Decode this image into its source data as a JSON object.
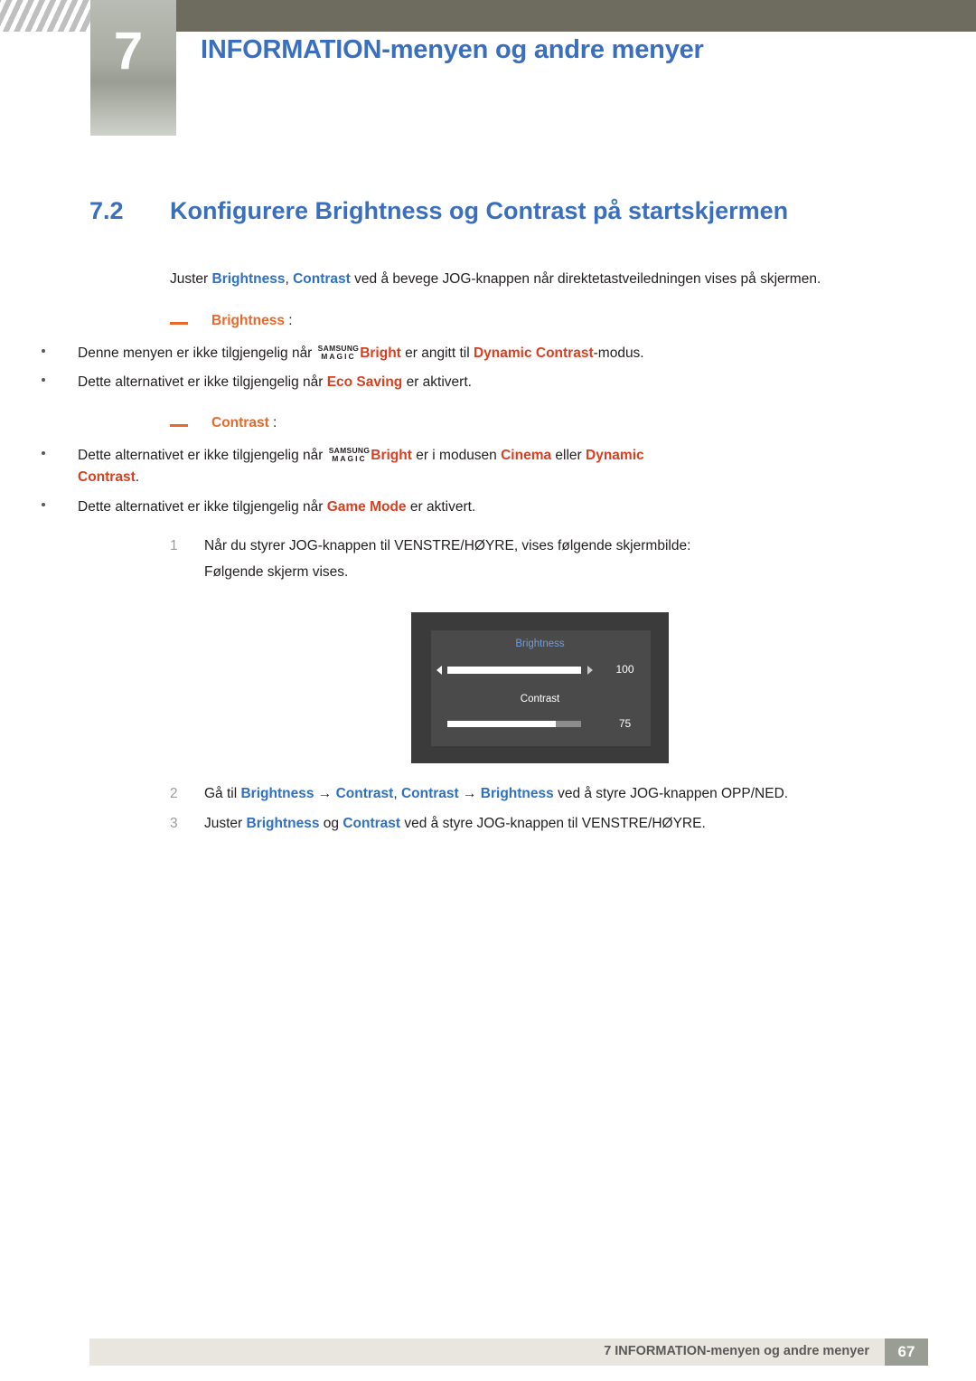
{
  "header": {
    "chapter_number": "7",
    "chapter_title": "INFORMATION-menyen og andre menyer"
  },
  "section": {
    "number": "7.2",
    "title": "Konfigurere Brightness og Contrast på startskjermen"
  },
  "intro": {
    "p1": "Juster ",
    "brightness": "Brightness",
    "comma": ", ",
    "contrast": "Contrast",
    "p2": " ved å bevege JOG-knappen når direktetastveiledningen vises på skjermen."
  },
  "notes": [
    {
      "heading": "Brightness",
      "colon": " :",
      "bullets": [
        {
          "pre": "Denne menyen er ikke tilgjengelig når ",
          "logo_top": "SAMSUNG",
          "logo_bottom": "MAGIC",
          "logo_word": "Bright",
          "mid": " er angitt til ",
          "term": "Dynamic Contrast",
          "post": "-modus."
        },
        {
          "pre": "Dette alternativet er ikke tilgjengelig når ",
          "term": "Eco Saving",
          "post": " er aktivert."
        }
      ]
    },
    {
      "heading": "Contrast",
      "colon": " :",
      "bullets": [
        {
          "pre": "Dette alternativet er ikke tilgjengelig når ",
          "logo_top": "SAMSUNG",
          "logo_bottom": "MAGIC",
          "logo_word": "Bright",
          "mid": " er i modusen ",
          "term": "Cinema",
          "mid2": " eller ",
          "term2": "Dynamic",
          "term2b": "Contrast",
          "post": "."
        },
        {
          "pre": "Dette alternativet er ikke tilgjengelig når ",
          "term": "Game Mode",
          "post": " er aktivert."
        }
      ]
    }
  ],
  "steps": [
    {
      "num": "1",
      "text": "Når du styrer JOG-knappen til VENSTRE/HØYRE, vises følgende skjermbilde:",
      "sub": "Følgende skjerm vises."
    },
    {
      "num": "2",
      "pre": "Gå til ",
      "t1": "Brightness",
      "arrow1": " → ",
      "t2": "Contrast",
      "sep": ", ",
      "t3": "Contrast",
      "arrow2": " → ",
      "t4": "Brightness",
      "post": " ved å styre JOG-knappen OPP/NED."
    },
    {
      "num": "3",
      "pre": "Juster ",
      "t1": "Brightness",
      "mid": " og ",
      "t2": "Contrast",
      "post": " ved å styre JOG-knappen til VENSTRE/HØYRE."
    }
  ],
  "osd": {
    "brightness_label": "Brightness",
    "brightness_value": "100",
    "contrast_label": "Contrast",
    "contrast_value": "75"
  },
  "footer": {
    "text": "7 INFORMATION-menyen og andre menyer",
    "page": "67"
  },
  "colors": {
    "heading_blue": "#3a6fbf",
    "accent_orange": "#e8672a",
    "term_red": "#d93f1f",
    "header_bar": "#6e6c5e"
  }
}
